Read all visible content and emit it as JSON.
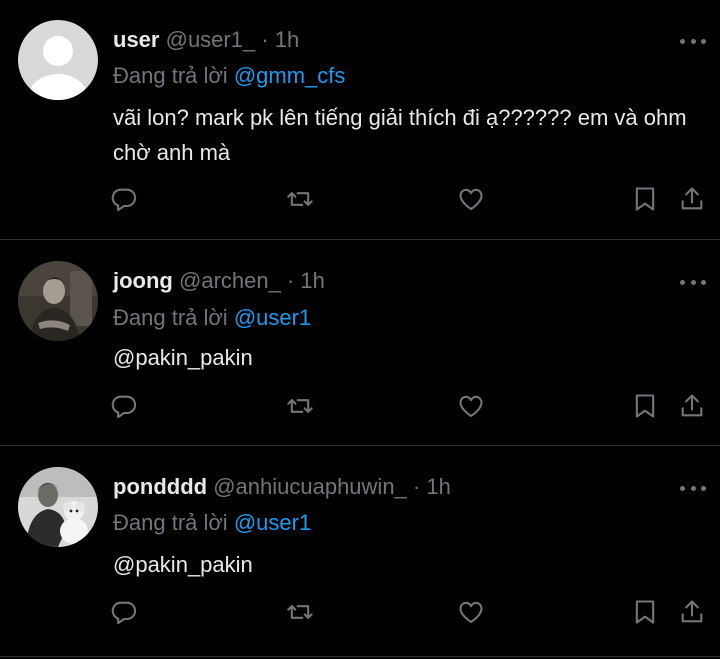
{
  "tweets": [
    {
      "name": "user",
      "handle": "@user1_",
      "separator": "·",
      "time": "1h",
      "reply_prefix": "Đang trả lời",
      "reply_to": "@gmm_cfs",
      "text": "vãi lon? mark pk lên tiếng giải thích đi ạ?????? em và ohm chờ anh mà"
    },
    {
      "name": "joong",
      "handle": "@archen_",
      "separator": "·",
      "time": "1h",
      "reply_prefix": "Đang trả lời",
      "reply_to": "@user1",
      "text": "@pakin_pakin"
    },
    {
      "name": "pondddd",
      "handle": "@anhiucuaphuwin_",
      "separator": "·",
      "time": "1h",
      "reply_prefix": "Đang trả lời",
      "reply_to": "@user1",
      "text": "@pakin_pakin"
    }
  ],
  "icons": {
    "reply": "reply-icon",
    "retweet": "retweet-icon",
    "like": "heart-icon",
    "bookmark": "bookmark-icon",
    "share": "share-icon",
    "more": "more-icon"
  },
  "colors": {
    "background": "#000000",
    "text": "#e7e9ea",
    "muted": "#71767b",
    "link": "#1d9bf0",
    "divider": "#2f3336"
  }
}
